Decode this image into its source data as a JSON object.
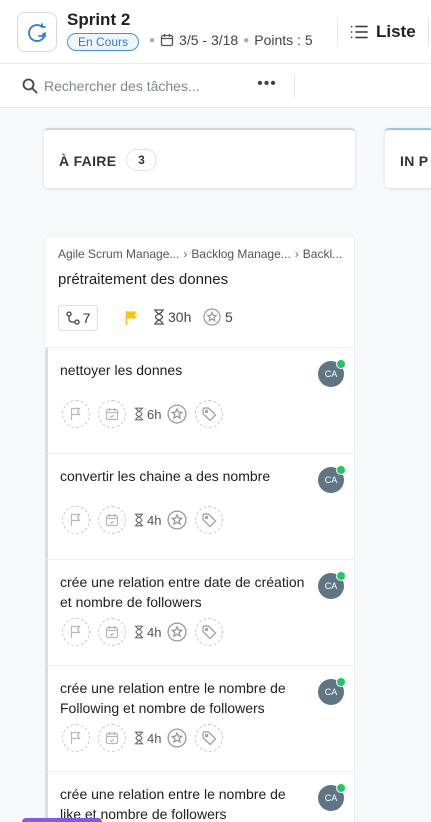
{
  "header": {
    "sprint_title": "Sprint 2",
    "status": "En Cours",
    "dates": "3/5 - 3/18",
    "points": "Points : 5",
    "view_label": "Liste"
  },
  "toolbar": {
    "search_placeholder": "Rechercher des tâches...",
    "more_label": "•••"
  },
  "columns": [
    {
      "title": "À FAIRE",
      "count": "3"
    },
    {
      "title": "IN P"
    }
  ],
  "parent_task": {
    "breadcrumb": [
      "Agile Scrum Manage...",
      "Backlog Manage...",
      "Backl..."
    ],
    "title": "prétraitement des donnes",
    "subtask_count": "7",
    "time_estimate": "30h",
    "points": "5",
    "priority_color": "#f5c518"
  },
  "subtasks": [
    {
      "title": "nettoyer les donnes",
      "estimate": "6h",
      "assignee": "CA"
    },
    {
      "title": "convertir les chaine a des nombre",
      "estimate": "4h",
      "assignee": "CA"
    },
    {
      "title": "crée une relation entre date de création et nombre de followers",
      "estimate": "4h",
      "assignee": "CA"
    },
    {
      "title": "crée une relation entre le nombre de Following et nombre de followers",
      "estimate": "4h",
      "assignee": "CA"
    },
    {
      "title": "crée une relation entre le nombre de like et nombre de followers",
      "estimate": "",
      "assignee": "CA"
    }
  ],
  "colors": {
    "accent": "#2d7dd2",
    "online": "#22c55e",
    "avatar": "#5f7584"
  }
}
